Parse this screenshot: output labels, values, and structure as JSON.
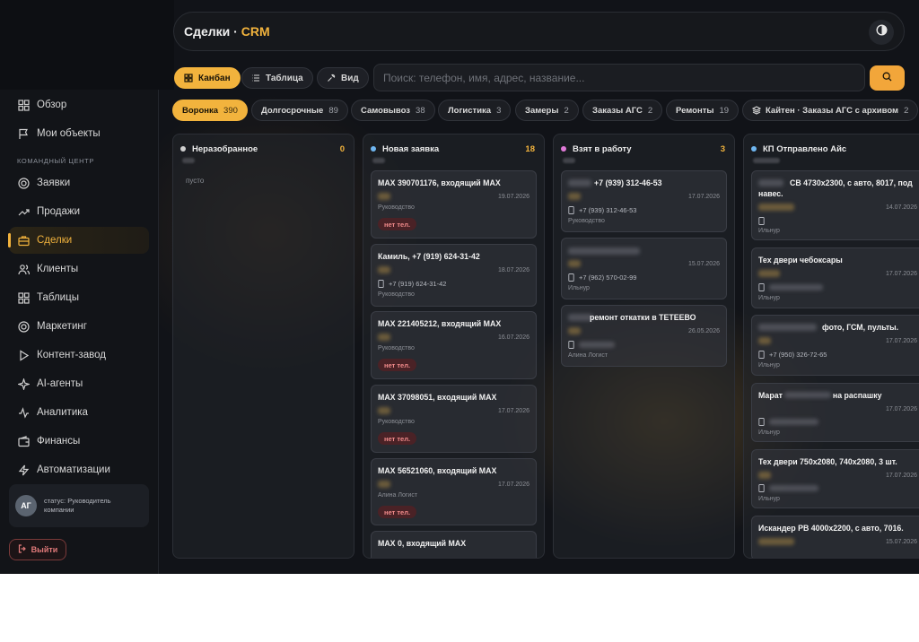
{
  "header": {
    "title": "Сделки",
    "separator": " · ",
    "title_accent": "CRM",
    "theme_icon": "contrast-icon"
  },
  "sidebar": {
    "section_label": "КОМАНДНЫЙ ЦЕНТР",
    "items": [
      {
        "label": "Обзор",
        "icon": "grid-icon"
      },
      {
        "label": "Мои объекты",
        "icon": "flag-icon"
      },
      {
        "label": "Заявки",
        "icon": "target-icon"
      },
      {
        "label": "Продажи",
        "icon": "trending-up-icon"
      },
      {
        "label": "Сделки",
        "icon": "briefcase-icon",
        "active": true
      },
      {
        "label": "Клиенты",
        "icon": "users-icon"
      },
      {
        "label": "Таблицы",
        "icon": "grid-icon"
      },
      {
        "label": "Маркетинг",
        "icon": "target-icon"
      },
      {
        "label": "Контент-завод",
        "icon": "play-icon"
      },
      {
        "label": "AI-агенты",
        "icon": "sparkle-icon"
      },
      {
        "label": "Аналитика",
        "icon": "activity-icon"
      },
      {
        "label": "Финансы",
        "icon": "wallet-icon"
      },
      {
        "label": "Автоматизации",
        "icon": "lightning-icon"
      }
    ],
    "profile": {
      "initials": "АГ",
      "status": "статус: Руководитель компании"
    },
    "logout_label": "Выйти"
  },
  "toolbar": {
    "views": [
      {
        "label": "Канбан",
        "active": true
      },
      {
        "label": "Таблица"
      },
      {
        "label": "Вид"
      }
    ],
    "search_placeholder": "Поиск: телефон, имя, адрес, название..."
  },
  "tabs": [
    {
      "label": "Воронка",
      "count": "390",
      "active": true
    },
    {
      "label": "Долгосрочные",
      "count": "89"
    },
    {
      "label": "Самовывоз",
      "count": "38"
    },
    {
      "label": "Логистика",
      "count": "3"
    },
    {
      "label": "Замеры",
      "count": "2"
    },
    {
      "label": "Заказы АГС",
      "count": "2"
    },
    {
      "label": "Ремонты",
      "count": "19"
    },
    {
      "label": "Кайтен · Заказы АГС с архивом",
      "count": "2"
    }
  ],
  "columns": [
    {
      "title": "Неразобранное",
      "count": "0",
      "dot_color": "#d0d0d0",
      "empty_text": "пусто",
      "cards": []
    },
    {
      "title": "Новая заявка",
      "count": "18",
      "dot_color": "#6fb6f0",
      "cards": [
        {
          "title": "MAX 390701176, входящий MAX",
          "date": "19.07.2026",
          "owner": "Руководство",
          "badge": "нет тел."
        },
        {
          "title": "Камиль, +7 (919) 624-31-42",
          "date": "18.07.2026",
          "phone": "+7 (919) 624-31-42",
          "owner": "Руководство"
        },
        {
          "title": "MAX 221405212, входящий MAX",
          "date": "16.07.2026",
          "owner": "Руководство",
          "badge": "нет тел."
        },
        {
          "title": "MAX 37098051, входящий MAX",
          "date": "17.07.2026",
          "owner": "Руководство",
          "badge": "нет тел."
        },
        {
          "title": "MAX 56521060, входящий MAX",
          "date": "17.07.2026",
          "owner": "Алина Логист",
          "badge": "нет тел."
        },
        {
          "title": "MAX 0, входящий MAX"
        }
      ]
    },
    {
      "title": "Взят в работу",
      "count": "3",
      "dot_color": "#e07ad8",
      "cards": [
        {
          "title": "+7 (939) 312-46-53",
          "date": "17.07.2026",
          "phone": "+7 (939) 312-46-53",
          "owner": "Руководство"
        },
        {
          "title": "",
          "date": "15.07.2026",
          "phone": "+7 (962) 570-02-99",
          "owner": "Ильнур"
        },
        {
          "title": "ремонт откатки в ТЕТЕЕВО",
          "date": "26.05.2026",
          "owner": "Алина Логист"
        }
      ]
    },
    {
      "title": "КП Отправлено Айс",
      "count": "",
      "dot_color": "#6fb6f0",
      "cards": [
        {
          "title": "СВ 4730х2300, с авто, 8017, под навес.",
          "date": "14.07.2026",
          "owner": "Ильнур"
        },
        {
          "title": "Тех двери чебоксары",
          "date": "17.07.2026",
          "owner": "Ильнур"
        },
        {
          "title": "фото, ГСМ, пульты.",
          "date": "17.07.2026",
          "phone": "+7 (950) 326-72-65",
          "owner": "Ильнур"
        },
        {
          "title": "Марат",
          "title_tail": "на распашку",
          "date": "17.07.2026",
          "owner": "Ильнур"
        },
        {
          "title": "Тех двери 750х2080, 740х2080, 3 шт.",
          "date": "17.07.2026",
          "owner": "Ильнур"
        },
        {
          "title": "Искандер РВ 4000х2200, с авто, 7016.",
          "date": "15.07.2026"
        }
      ]
    }
  ],
  "colors": {
    "accent": "#f2b33d",
    "danger": "#f08a8a",
    "background": "#111318"
  }
}
